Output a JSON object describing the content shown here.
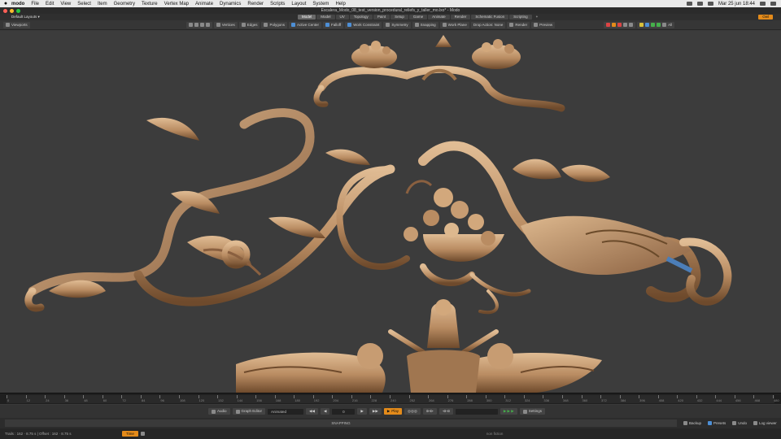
{
  "menubar": {
    "app_name": "modo",
    "items": [
      "File",
      "Edit",
      "View",
      "Select",
      "Item",
      "Geometry",
      "Texture",
      "Vertex Map",
      "Animate",
      "Dynamics",
      "Render",
      "Scripts",
      "Layout",
      "System",
      "Help"
    ],
    "clock": "Mar 25 jun  18:44"
  },
  "window": {
    "title": "Escalera_Modo_08_test_version_procedural_reliefs_y_taller_mo.lxo* - Modo"
  },
  "layout": {
    "dropdown": "Default Layouts ▾",
    "tabs": [
      "Model",
      "Model",
      "UV",
      "Topology",
      "Paint",
      "Setup",
      "Game",
      "Animate",
      "Render",
      "Schematic Fusion",
      "Scripting"
    ],
    "active_tab": 0,
    "add_tab": "+",
    "right_button": "Owl"
  },
  "toolbar": {
    "left_label": "Viewports",
    "items": [
      "Vertices",
      "Edges",
      "Polygons",
      "Active Center",
      "Falloff",
      "Work Constraint",
      "Symmetry",
      "Snapping",
      "Work Plane",
      "Drop Action: None",
      "Render",
      "Preview",
      "All"
    ]
  },
  "timeline": {
    "ticks": [
      "0",
      "12",
      "24",
      "36",
      "48",
      "60",
      "72",
      "84",
      "96",
      "108",
      "120",
      "132",
      "144",
      "156",
      "168",
      "180",
      "192",
      "204",
      "216",
      "228",
      "240",
      "252",
      "264",
      "276",
      "288",
      "300",
      "312",
      "324",
      "336",
      "348",
      "360",
      "372",
      "384",
      "396",
      "408",
      "420",
      "432",
      "444",
      "456",
      "468",
      "480"
    ]
  },
  "playback": {
    "audio": "Audio",
    "graph_editor": "Graph Editor",
    "animated": "Animated",
    "frame": "0",
    "play": "Play",
    "keys_field": "",
    "settings": "Settings"
  },
  "command": {
    "placeholder": "",
    "center_text": "SNAPPING",
    "buttons": [
      "Backup",
      "Presets",
      "Undo",
      "Log viewer"
    ]
  },
  "status": {
    "left": "Trails : 162 · 8.75 s | Offset : 162 · 8.75 s",
    "chips": [
      "Time"
    ],
    "mid": "non fiction"
  },
  "colors": {
    "accent": "#e48b1a",
    "wood_light": "#c9a27a",
    "wood_dark": "#7a5535",
    "viewport_bg": "#3c3c3c"
  }
}
